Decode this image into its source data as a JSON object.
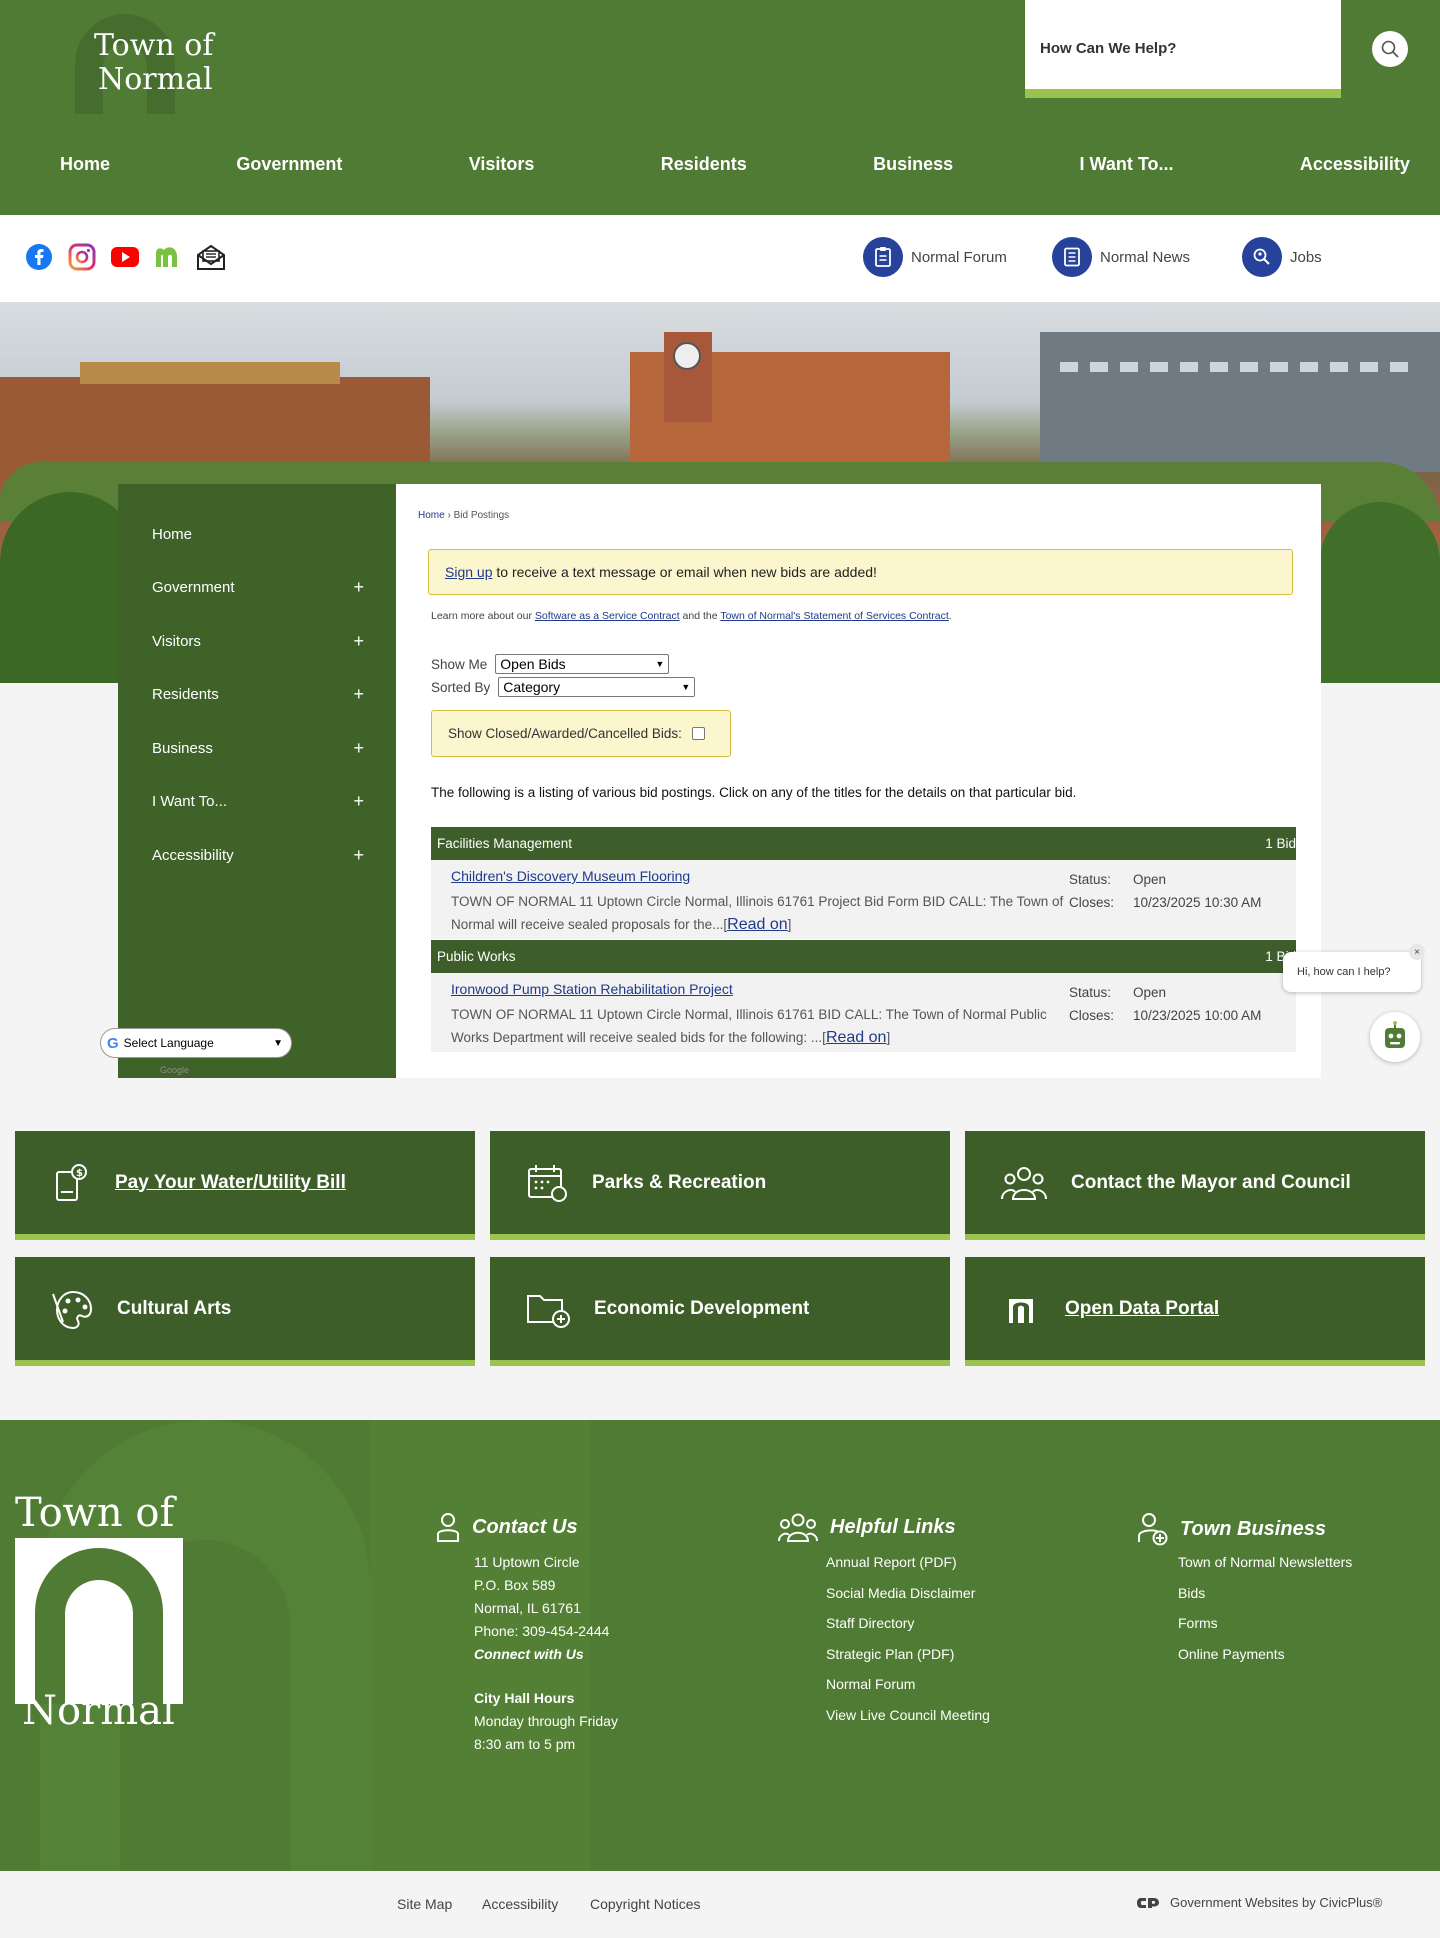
{
  "header": {
    "logo_line1": "Town of",
    "logo_line2": "Normal",
    "search_placeholder": "How Can We Help?"
  },
  "nav": [
    "Home",
    "Government",
    "Visitors",
    "Residents",
    "Business",
    "I Want To...",
    "Accessibility"
  ],
  "social": [
    "facebook-icon",
    "instagram-icon",
    "youtube-icon",
    "normal-n-icon",
    "newsletter-icon"
  ],
  "quick_links": {
    "forum": "Normal Forum",
    "news": "Normal News",
    "jobs": "Jobs"
  },
  "sidenav": [
    "Home",
    "Government",
    "Visitors",
    "Residents",
    "Business",
    "I Want To...",
    "Accessibility"
  ],
  "sidenav_plus": "+",
  "language": {
    "label": "Select Language",
    "credit": "Google"
  },
  "content": {
    "breadcrumb_home": "Home",
    "breadcrumb_sep": "›",
    "breadcrumb_current": "Bid Postings",
    "signup_link": "Sign up",
    "signup_text": " to receive a text message or email when new bids are added!",
    "learn_prefix": "Learn more about our ",
    "learn_link1": "Software as a Service Contract",
    "learn_mid": " and the ",
    "learn_link2": "Town of Normal's Statement of Services Contract",
    "learn_suffix": ".",
    "show_me_label": "Show Me",
    "show_me_value": "Open Bids",
    "sorted_by_label": "Sorted By",
    "sorted_by_value": "Category",
    "closed_label": "Show Closed/Awarded/Cancelled Bids:",
    "intro": "The following is a listing of various bid postings. Click on any of the titles for the details on that particular bid.",
    "categories": [
      {
        "name": "Facilities Management",
        "count": "1 Bid",
        "bid": {
          "title": "Children's Discovery Museum Flooring",
          "desc": "TOWN OF NORMAL 11 Uptown Circle Normal, Illinois 61761 Project Bid Form BID CALL: The Town of Normal will receive sealed proposals for the...",
          "status_label": "Status:",
          "status": "Open",
          "closes_label": "Closes:",
          "closes": "10/23/2025 10:30 AM"
        }
      },
      {
        "name": "Public Works",
        "count": "1 Bid",
        "bid": {
          "title": "Ironwood Pump Station Rehabilitation Project",
          "desc": "TOWN OF NORMAL 11 Uptown Circle Normal, Illinois 61761 BID CALL: The Town of Normal Public Works Department will receive sealed bids for the following: ...",
          "status_label": "Status:",
          "status": "Open",
          "closes_label": "Closes:",
          "closes": "10/23/2025 10:00 AM"
        }
      }
    ],
    "read_on_open": "[",
    "read_on": "Read on",
    "read_on_close": "]"
  },
  "chat": {
    "prompt": "Hi, how can I help?",
    "close": "×"
  },
  "tiles": [
    "Pay Your Water/Utility Bill",
    "Parks & Recreation",
    "Contact the Mayor and Council",
    "Cultural Arts",
    "Economic Development",
    "Open Data Portal"
  ],
  "footer": {
    "logo_line1": "Town of",
    "logo_line2": "Normal",
    "contact_title": "Contact Us",
    "contact_lines": [
      "11 Uptown Circle",
      "P.O. Box 589",
      "Normal, IL 61761",
      "Phone: 309-454-2444"
    ],
    "connect": "Connect with Us",
    "hours_title": "City Hall Hours",
    "hours_lines": [
      "Monday through Friday",
      "8:30 am to 5 pm"
    ],
    "helpful_title": "Helpful Links",
    "helpful_links": [
      "Annual Report (PDF)",
      "Social Media Disclaimer",
      "Staff Directory",
      "Strategic Plan (PDF)",
      "Normal Forum",
      "View Live Council Meeting"
    ],
    "business_title": "Town Business",
    "business_links": [
      "Town of Normal Newsletters",
      "Bids",
      "Forms",
      "Online Payments"
    ]
  },
  "bottom": {
    "sitemap": "Site Map",
    "accessibility": "Accessibility",
    "copyright": "Copyright Notices",
    "civic": "Government Websites by CivicPlus®"
  },
  "colors": {
    "brand_green": "#4f7b34",
    "dark_green": "#3e5e29",
    "accent_lime": "#9ac34f",
    "link_blue": "#1f3a8a",
    "notice_yellow": "#fcf6ce"
  }
}
